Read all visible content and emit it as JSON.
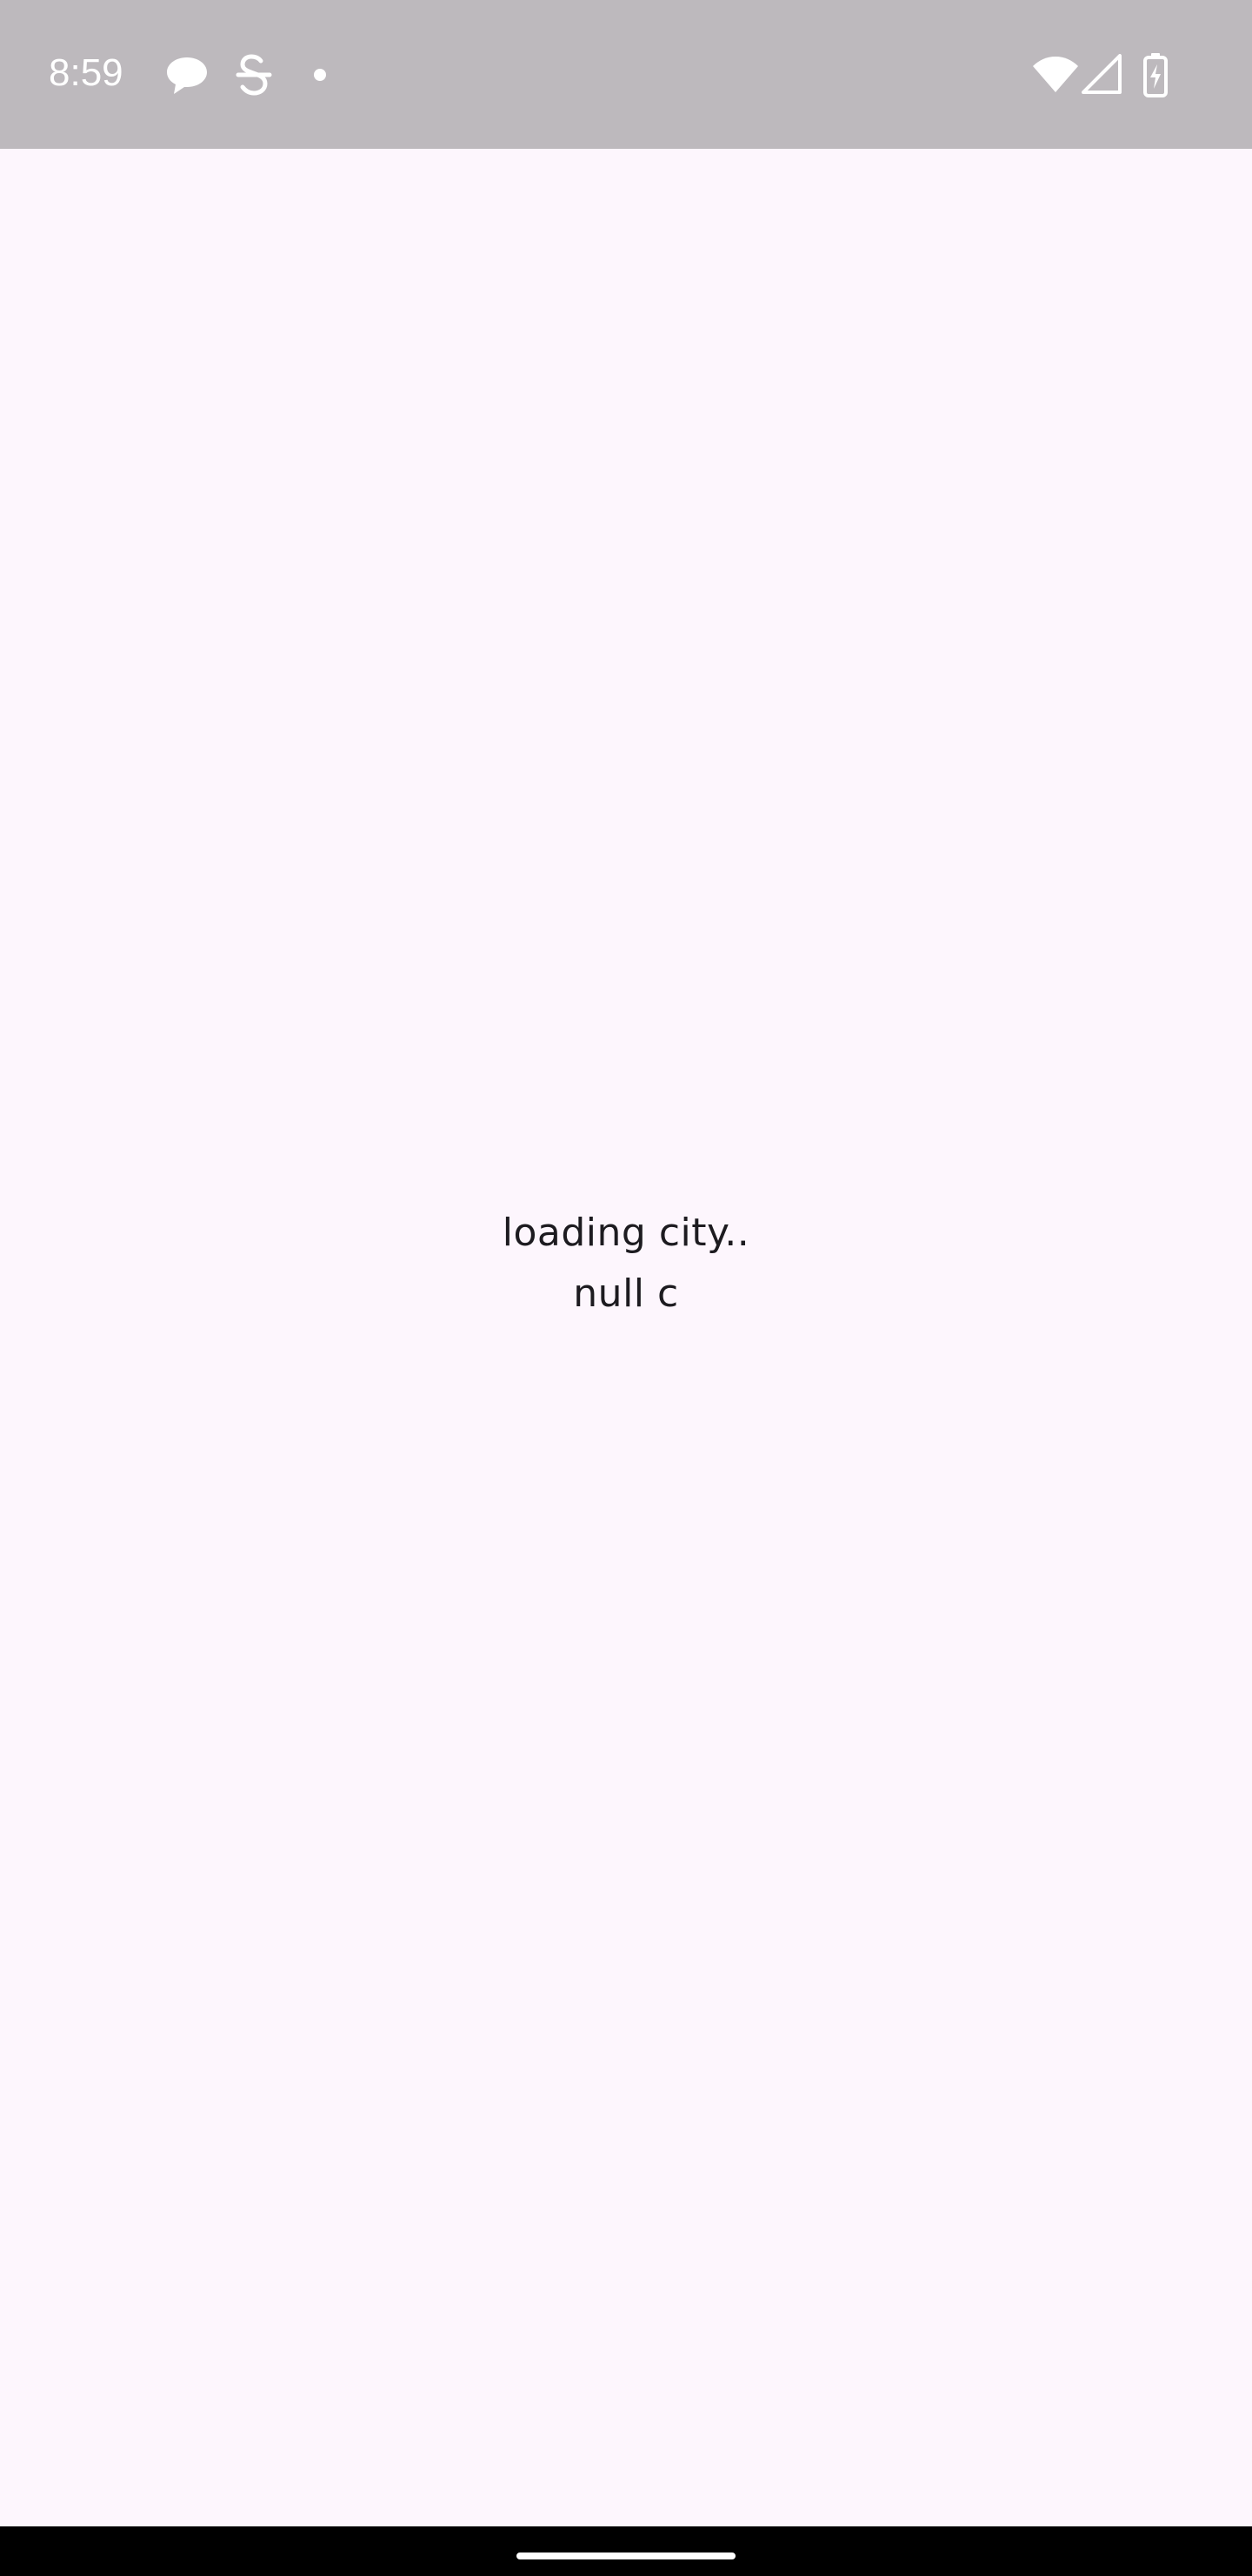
{
  "status_bar": {
    "time": "8:59",
    "notification_icons": [
      "chat-bubble-icon",
      "s-app-icon",
      "dot-icon"
    ],
    "system_icons": [
      "wifi-icon",
      "signal-icon",
      "battery-charging-icon"
    ],
    "background_color": "#bdb9bd"
  },
  "main": {
    "message_line_1": "loading city..",
    "message_line_2": "null c",
    "background_color": "#fdf6fd",
    "text_color": "#1d1b20"
  },
  "nav_bar": {
    "background_color": "#000000",
    "handle_color": "#ffffff"
  }
}
